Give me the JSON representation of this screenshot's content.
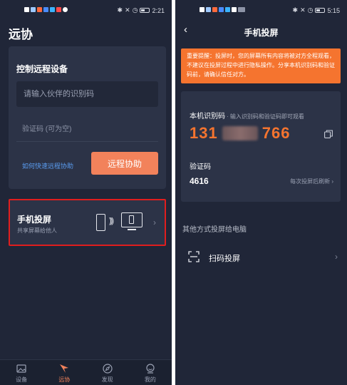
{
  "left": {
    "status": {
      "time": "2:21"
    },
    "app_title": "远协",
    "remote": {
      "title": "控制远程设备",
      "id_placeholder": "请输入伙伴的识别码",
      "code_placeholder": "验证码 (可为空)",
      "help_link": "如何快速远程协助",
      "assist_button": "远程协助"
    },
    "cast": {
      "title": "手机投屏",
      "subtitle": "共享屏幕给他人",
      "chevron": "›",
      "waves": ")))"
    },
    "tabs": [
      {
        "label": "设备",
        "icon": "image-icon"
      },
      {
        "label": "远协",
        "icon": "remote-assist-icon",
        "active": true
      },
      {
        "label": "发现",
        "icon": "compass-icon"
      },
      {
        "label": "我的",
        "icon": "profile-icon"
      }
    ]
  },
  "right": {
    "status": {
      "time": "5:15"
    },
    "back": "‹",
    "page_title": "手机投屏",
    "notice": "重要提醒：投屏时，您的屏幕所有内容将被对方全程观看，不建议在投屏过程中进行隐私操作。分享本机识别码和验证码前，请确认信任对方。",
    "id_label": "本机识别码",
    "id_hint": "· 输入识别码和验证码即可观看",
    "id_prefix": "131",
    "id_suffix": "766",
    "code_label": "验证码",
    "code_value": "4616",
    "refresh_note": "每次投屏后刷新 ›",
    "other_title": "其他方式投屏给电脑",
    "scan_label": "扫码投屏",
    "scan_chevron": "›"
  },
  "colors": {
    "background": "#202638",
    "card": "#2c3347",
    "accent": "#f2825b",
    "notice": "#f5742f",
    "link": "#5a9cf0",
    "highlight_border": "#e01e1e"
  }
}
